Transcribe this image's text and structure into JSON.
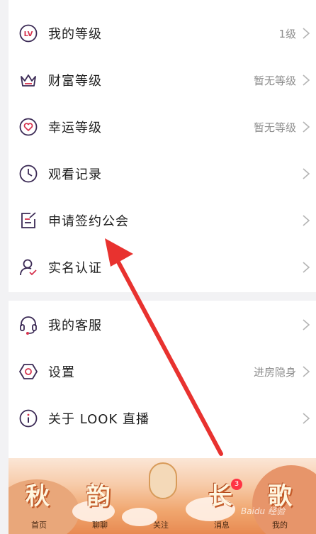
{
  "menu_top": [
    {
      "label": "我的等级",
      "value": "1级",
      "icon": "level-icon"
    },
    {
      "label": "财富等级",
      "value": "暂无等级",
      "icon": "crown-icon"
    },
    {
      "label": "幸运等级",
      "value": "暂无等级",
      "icon": "heart-icon"
    },
    {
      "label": "观看记录",
      "value": "",
      "icon": "clock-icon"
    },
    {
      "label": "申请签约公会",
      "value": "",
      "icon": "edit-icon"
    },
    {
      "label": "实名认证",
      "value": "",
      "icon": "user-verify-icon"
    }
  ],
  "menu_bottom": [
    {
      "label": "我的客服",
      "value": "",
      "icon": "headset-icon"
    },
    {
      "label": "设置",
      "value": "进房隐身",
      "icon": "settings-icon"
    },
    {
      "label": "关于 LOOK 直播",
      "value": "",
      "icon": "info-icon"
    }
  ],
  "tabbar": {
    "chars": [
      "秋",
      "韵",
      "长",
      "歌"
    ],
    "tabs": [
      "首页",
      "聊聊",
      "关注",
      "消息",
      "我的"
    ],
    "message_badge": "3"
  },
  "watermark": "Baidu 经验",
  "colors": {
    "accent": "#5b2a86",
    "icon_pink": "#e0435a",
    "arrow": "#e8322f"
  }
}
